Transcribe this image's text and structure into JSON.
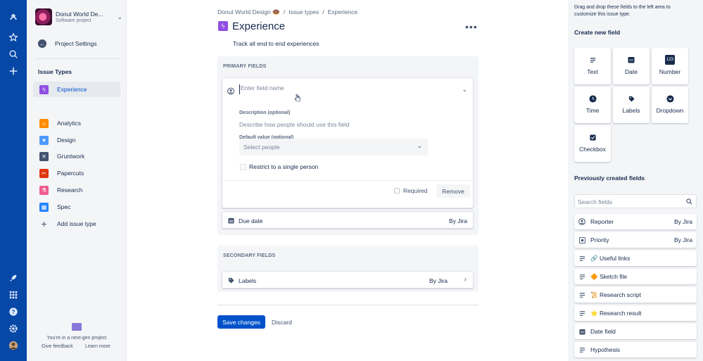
{
  "project": {
    "name": "Donut World De...",
    "type": "Software project"
  },
  "sidebar": {
    "settings_label": "Project Settings",
    "section_title": "Issue Types",
    "active_item": "Experience",
    "items": [
      {
        "label": "Analytics",
        "color": "#ff8b00"
      },
      {
        "label": "Design",
        "color": "#4c9aff"
      },
      {
        "label": "Gruntwork",
        "color": "#42526e"
      },
      {
        "label": "Papercuts",
        "color": "#de350b"
      },
      {
        "label": "Research",
        "color": "#f15b8f"
      },
      {
        "label": "Spec",
        "color": "#2684ff"
      }
    ],
    "add_label": "Add issue type",
    "footer_text": "You're in a next-gen project",
    "feedback_link": "Give feedback",
    "learn_link": "Learn more"
  },
  "breadcrumbs": {
    "project": "Donut World Design 🍩",
    "sep": "/",
    "section": "Issue types",
    "current": "Experience"
  },
  "page": {
    "title": "Experience",
    "description": "Track all end to end experiences",
    "accent": "#904ee2"
  },
  "primary": {
    "heading": "PRIMARY FIELDS",
    "editor": {
      "name_placeholder": "Enter field name",
      "desc_label": "Description (optional)",
      "desc_placeholder": "Describe how people should use this field",
      "default_label": "Default value (optional)",
      "select_placeholder": "Select people",
      "restrict_label": "Restrict to a single person",
      "required_label": "Required",
      "remove_label": "Remove"
    },
    "rows": [
      {
        "label": "Due date",
        "by": "By Jira"
      }
    ]
  },
  "secondary": {
    "heading": "SECONDARY FIELDS",
    "rows": [
      {
        "label": "Labels",
        "by": "By Jira"
      }
    ]
  },
  "actions": {
    "save": "Save changes",
    "discard": "Discard",
    "save_color": "#0052cc"
  },
  "right_panel": {
    "tip": "Drag and drop these fields to the left area to customize this issue type.",
    "create_heading": "Create new field",
    "types": [
      "Text",
      "Date",
      "Number",
      "Time",
      "Labels",
      "Dropdown",
      "Checkbox"
    ],
    "number_badge": "123",
    "previous_heading": "Previously created fields",
    "search_placeholder": "Search fields",
    "previous": [
      {
        "label": "Reporter",
        "by": "By Jira",
        "icon": "person-icon"
      },
      {
        "label": "Priority",
        "by": "By Jira",
        "icon": "priority-icon"
      },
      {
        "label": "🔗 Useful links",
        "by": "",
        "icon": "paragraph-icon"
      },
      {
        "label": "🔶 Sketch file",
        "by": "",
        "icon": "paragraph-icon"
      },
      {
        "label": "📜 Research script",
        "by": "",
        "icon": "paragraph-icon"
      },
      {
        "label": "⭐ Research result",
        "by": "",
        "icon": "paragraph-icon"
      },
      {
        "label": "Date field",
        "by": "",
        "icon": "calendar-icon"
      },
      {
        "label": "Hypothesis",
        "by": "",
        "icon": "paragraph-icon"
      }
    ]
  }
}
